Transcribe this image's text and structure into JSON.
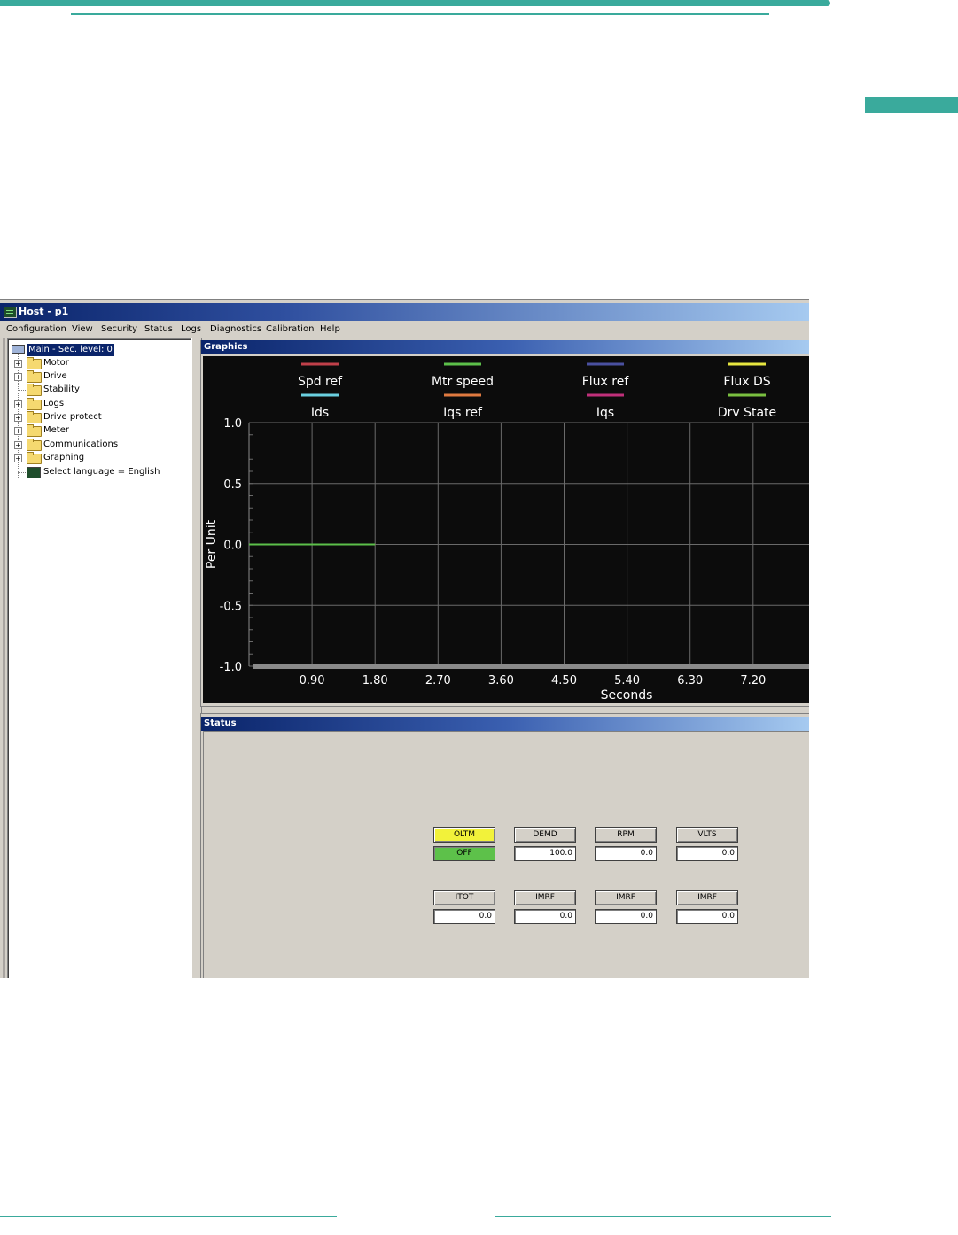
{
  "window": {
    "title": "Host - p1"
  },
  "menu": [
    "Configuration",
    "View",
    "Security",
    "Status",
    "Logs",
    "Diagnostics",
    "Calibration",
    "Help"
  ],
  "tree": {
    "root": "Main - Sec. level: 0",
    "items": [
      {
        "label": "Motor",
        "expandable": true
      },
      {
        "label": "Drive",
        "expandable": true
      },
      {
        "label": "Stability",
        "expandable": false
      },
      {
        "label": "Logs",
        "expandable": true
      },
      {
        "label": "Drive protect",
        "expandable": true
      },
      {
        "label": "Meter",
        "expandable": true
      },
      {
        "label": "Communications",
        "expandable": true
      },
      {
        "label": "Graphing",
        "expandable": true
      },
      {
        "label": "Select language = English",
        "expandable": false,
        "icon": "graph-icon"
      }
    ]
  },
  "graphics_panel": {
    "title": "Graphics"
  },
  "status_panel": {
    "title": "Status",
    "rows": [
      [
        {
          "label": "OLTM",
          "value": "OFF",
          "label_color": "#f2f23a",
          "value_color": "#5dc14a"
        },
        {
          "label": "DEMD",
          "value": "100.0"
        },
        {
          "label": "RPM",
          "value": "0.0"
        },
        {
          "label": "VLTS",
          "value": "0.0"
        }
      ],
      [
        {
          "label": "ITOT",
          "value": "0.0"
        },
        {
          "label": "IMRF",
          "value": "0.0"
        },
        {
          "label": "IMRF",
          "value": "0.0"
        },
        {
          "label": "IMRF",
          "value": "0.0"
        }
      ]
    ]
  },
  "colors": {
    "accent": "#3aaa9c",
    "titlebar_start": "#0a246a",
    "titlebar_end": "#a6caf0",
    "window_face": "#d4d0c8",
    "chart_bg": "#0c0c0c"
  },
  "chart_data": {
    "type": "line",
    "title": "",
    "xlabel": "Seconds",
    "ylabel": "Per Unit",
    "ylim": [
      -1.0,
      1.0
    ],
    "yticks": [
      "1.0",
      "0.5",
      "0.0",
      "-0.5",
      "-1.0"
    ],
    "xticks": [
      "0.90",
      "1.80",
      "2.70",
      "3.60",
      "4.50",
      "5.40",
      "6.30",
      "7.20"
    ],
    "xlim": [
      0.0,
      8.0
    ],
    "grid": true,
    "legend_placement": "top",
    "series": [
      {
        "name": "Spd ref",
        "color": "#c0404a",
        "x": [
          0.0,
          1.8
        ],
        "y": [
          0.0,
          0.0
        ]
      },
      {
        "name": "Mtr speed",
        "color": "#5cc04a",
        "x": [
          0.0,
          1.8
        ],
        "y": [
          0.0,
          0.0
        ]
      },
      {
        "name": "Flux ref",
        "color": "#4a50a0",
        "x": [],
        "y": []
      },
      {
        "name": "Flux DS",
        "color": "#e6e640",
        "x": [],
        "y": []
      },
      {
        "name": "Ids",
        "color": "#6ad0e0",
        "x": [],
        "y": []
      },
      {
        "name": "Iqs ref",
        "color": "#e07a40",
        "x": [],
        "y": []
      },
      {
        "name": "Iqs",
        "color": "#c0307a",
        "x": [],
        "y": []
      },
      {
        "name": "Drv State",
        "color": "#7ac040",
        "x": [],
        "y": []
      }
    ]
  }
}
